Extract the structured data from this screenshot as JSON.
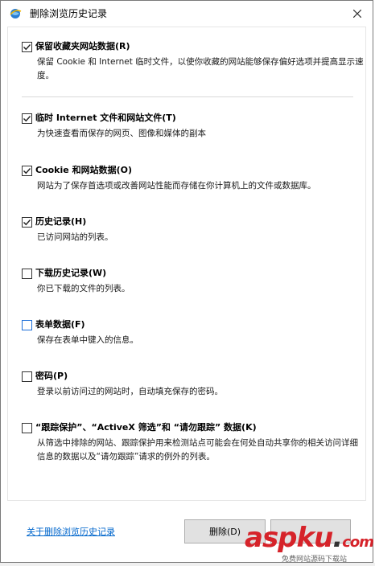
{
  "window": {
    "title": "删除浏览历史记录",
    "close_glyph": "✕"
  },
  "options": [
    {
      "label": "保留收藏夹网站数据(R)",
      "description": "保留 Cookie 和 Internet 临时文件，以使你收藏的网站能够保存偏好选项并提高显示速度。",
      "checked": true
    },
    {
      "label": "临时 Internet 文件和网站文件(T)",
      "description": "为快速查看而保存的网页、图像和媒体的副本",
      "checked": true
    },
    {
      "label": "Cookie 和网站数据(O)",
      "description": "网站为了保存首选项或改善网站性能而存储在你计算机上的文件或数据库。",
      "checked": true
    },
    {
      "label": "历史记录(H)",
      "description": "已访问网站的列表。",
      "checked": true
    },
    {
      "label": "下载历史记录(W)",
      "description": "你已下载的文件的列表。",
      "checked": false
    },
    {
      "label": "表单数据(F)",
      "description": "保存在表单中键入的信息。",
      "checked": false
    },
    {
      "label": "密码(P)",
      "description": "登录以前访问过的网站时，自动填充保存的密码。",
      "checked": false
    },
    {
      "label": "“跟踪保护”、“ActiveX 筛选”和 “请勿跟踪” 数据(K)",
      "description": "从筛选中排除的网站、跟踪保护用来检测站点可能会在何处自动共享你的相关访问详细信息的数据以及“请勿跟踪”请求的例外的列表。",
      "checked": false
    }
  ],
  "footer": {
    "about_link": "关于删除浏览历史记录",
    "delete_button": "删除(D)",
    "cancel_button": ""
  },
  "watermark": {
    "main": "aspku",
    "dot": ".",
    "tld": "com",
    "sub": "免费网站源码下载站"
  },
  "colors": {
    "link": "#0066cc",
    "checkbox_focus": "#1e6fd9",
    "watermark": "#d6232a"
  },
  "icons": {
    "app": "ie-globe-icon",
    "close": "close-icon",
    "check": "checkmark-icon"
  }
}
